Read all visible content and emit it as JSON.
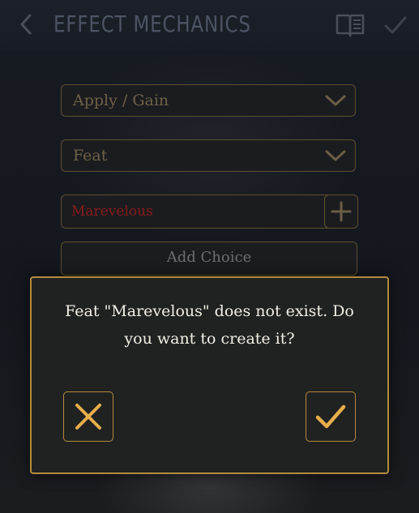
{
  "header": {
    "title": "EFFECT MECHANICS",
    "back_icon": "chevron-left-icon",
    "book_icon": "open-book-icon",
    "confirm_icon": "checkmark-icon"
  },
  "form": {
    "action_select": {
      "value": "Apply / Gain",
      "icon": "chevron-down-icon"
    },
    "type_select": {
      "value": "Feat",
      "icon": "chevron-down-icon"
    },
    "name_input": {
      "value": "Marevelous",
      "add_icon": "plus-icon"
    },
    "add_choice_label": "Add Choice"
  },
  "dialog": {
    "message_line1": "Feat \"Marevelous\" does not exist. Do",
    "message_line2": "you want to create it?",
    "cancel_icon": "close-x-icon",
    "confirm_icon": "checkmark-icon"
  },
  "colors": {
    "gold_accent": "#e7ae4a",
    "dialog_border": "#b48b3d",
    "error_text": "#8a1b1b",
    "dim_text": "#6d6148"
  }
}
